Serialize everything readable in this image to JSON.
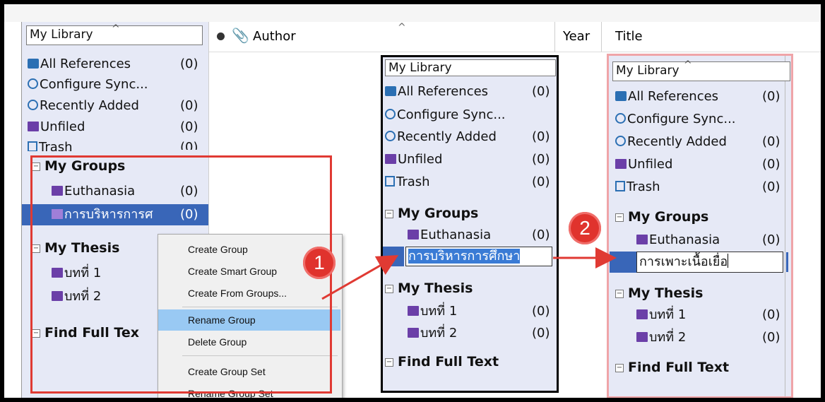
{
  "colors": {
    "panel_bg": "#e6e9f6",
    "selection": "#3966b8",
    "menu_highlight": "#99c9f3",
    "annotation_red": "#e03a33",
    "annotation_pink": "#efa4a8",
    "icon_purple": "#6b3fa8",
    "icon_blue": "#2b6fb3"
  },
  "columns": {
    "author": "Author",
    "year": "Year",
    "title": "Title"
  },
  "panel_left": {
    "header": "My Library",
    "items": [
      {
        "label": "All References",
        "count": "(0)",
        "icon": "all-references-icon"
      },
      {
        "label": "Configure Sync...",
        "count": "",
        "icon": "sync-icon"
      },
      {
        "label": "Recently Added",
        "count": "(0)",
        "icon": "recent-icon"
      },
      {
        "label": "Unfiled",
        "count": "(0)",
        "icon": "unfiled-icon"
      },
      {
        "label": "Trash",
        "count": "(0)",
        "icon": "trash-icon"
      }
    ],
    "my_groups": "My Groups",
    "groups": [
      {
        "label": "Euthanasia",
        "count": "(0)"
      },
      {
        "label": "การบริหารการศ",
        "count": "(0)"
      }
    ],
    "my_thesis": "My Thesis",
    "thesis": [
      {
        "label": "บทที่ 1"
      },
      {
        "label": "บทที่ 2"
      }
    ],
    "find_full_text": "Find Full Tex"
  },
  "context_menu": {
    "items": [
      "Create Group",
      "Create Smart Group",
      "Create From Groups...",
      "Rename Group",
      "Delete Group",
      "Create Group Set",
      "Rename Group Set"
    ],
    "active": "Rename Group"
  },
  "panel_middle": {
    "header": "My Library",
    "items": [
      {
        "label": "All References",
        "count": "(0)"
      },
      {
        "label": "Configure Sync...",
        "count": ""
      },
      {
        "label": "Recently Added",
        "count": "(0)"
      },
      {
        "label": "Unfiled",
        "count": "(0)"
      },
      {
        "label": "Trash",
        "count": "(0)"
      }
    ],
    "my_groups": "My Groups",
    "group_1": {
      "label": "Euthanasia",
      "count": "(0)"
    },
    "edit_value": "การบริหารการศึกษา",
    "my_thesis": "My Thesis",
    "thesis": [
      {
        "label": "บทที่ 1",
        "count": "(0)"
      },
      {
        "label": "บทที่ 2",
        "count": "(0)"
      }
    ],
    "find_full_text": "Find Full Text"
  },
  "panel_right": {
    "header": "My Library",
    "items": [
      {
        "label": "All References",
        "count": "(0)"
      },
      {
        "label": "Configure Sync...",
        "count": ""
      },
      {
        "label": "Recently Added",
        "count": "(0)"
      },
      {
        "label": "Unfiled",
        "count": "(0)"
      },
      {
        "label": "Trash",
        "count": "(0)"
      }
    ],
    "my_groups": "My Groups",
    "group_1": {
      "label": "Euthanasia",
      "count": "(0)"
    },
    "edit_value": "การเพาะเนื้อเยื่อ",
    "my_thesis": "My Thesis",
    "thesis": [
      {
        "label": "บทที่ 1",
        "count": "(0)"
      },
      {
        "label": "บทที่ 2",
        "count": "(0)"
      }
    ],
    "find_full_text": "Find Full Text"
  },
  "badges": {
    "step1": "1",
    "step2": "2"
  }
}
